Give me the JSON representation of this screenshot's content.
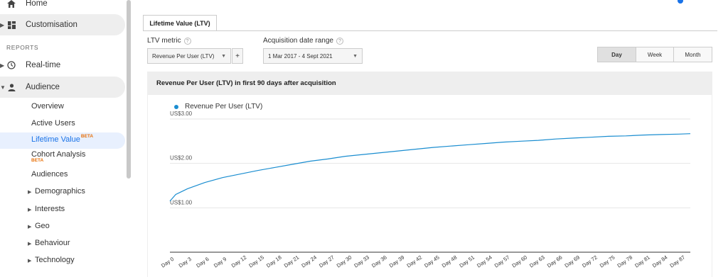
{
  "sidebar": {
    "home": "Home",
    "customisation": "Customisation",
    "section_reports": "REPORTS",
    "realtime": "Real-time",
    "audience": "Audience",
    "audience_items": {
      "overview": "Overview",
      "active_users": "Active Users",
      "lifetime_value": "Lifetime Value",
      "lifetime_value_badge": "BETA",
      "cohort_analysis": "Cohort Analysis",
      "cohort_badge": "BETA",
      "audiences": "Audiences"
    },
    "categories": [
      "Demographics",
      "Interests",
      "Geo",
      "Behaviour",
      "Technology"
    ]
  },
  "main": {
    "tab": "Lifetime Value (LTV)",
    "ltv_metric_label": "LTV metric",
    "ltv_metric_value": "Revenue Per User (LTV)",
    "plus_label": "+",
    "date_range_label": "Acquisition date range",
    "date_range_value": "1 Mar 2017 - 4 Sept 2021",
    "granularity": [
      "Day",
      "Week",
      "Month"
    ],
    "granularity_selected": "Day",
    "card_title": "Revenue Per User (LTV) in first 90 days after acquisition"
  },
  "colors": {
    "series": "#1a8dd0",
    "accent": "#1a73e8",
    "beta": "#e8710a"
  },
  "chart_data": {
    "type": "line",
    "legend": "top-left",
    "ylim": [
      0,
      3
    ],
    "yticks": [
      "US$1.00",
      "US$2.00",
      "US$3.00"
    ],
    "ytick_values": [
      1,
      2,
      3
    ],
    "series": [
      {
        "name": "Revenue Per User (LTV)",
        "x": [
          0,
          1,
          3,
          6,
          9,
          12,
          15,
          18,
          21,
          24,
          27,
          30,
          33,
          36,
          39,
          42,
          45,
          48,
          51,
          54,
          57,
          60,
          63,
          66,
          69,
          72,
          75,
          78,
          81,
          84,
          87,
          89
        ],
        "values": [
          1.15,
          1.3,
          1.43,
          1.57,
          1.68,
          1.76,
          1.84,
          1.91,
          1.98,
          2.05,
          2.1,
          2.16,
          2.2,
          2.24,
          2.28,
          2.32,
          2.36,
          2.39,
          2.42,
          2.45,
          2.48,
          2.5,
          2.52,
          2.55,
          2.57,
          2.59,
          2.61,
          2.62,
          2.64,
          2.65,
          2.66,
          2.67
        ]
      }
    ],
    "x_tick_labels": [
      "Day 0",
      "Day 3",
      "Day 6",
      "Day 9",
      "Day 12",
      "Day 15",
      "Day 18",
      "Day 21",
      "Day 24",
      "Day 27",
      "Day 30",
      "Day 33",
      "Day 36",
      "Day 39",
      "Day 42",
      "Day 45",
      "Day 48",
      "Day 51",
      "Day 54",
      "Day 57",
      "Day 60",
      "Day 63",
      "Day 66",
      "Day 69",
      "Day 72",
      "Day 75",
      "Day 78",
      "Day 81",
      "Day 84",
      "Day 87"
    ],
    "x_tick_values": [
      0,
      3,
      6,
      9,
      12,
      15,
      18,
      21,
      24,
      27,
      30,
      33,
      36,
      39,
      42,
      45,
      48,
      51,
      54,
      57,
      60,
      63,
      66,
      69,
      72,
      75,
      78,
      81,
      84,
      87
    ],
    "xlim": [
      0,
      89
    ]
  }
}
